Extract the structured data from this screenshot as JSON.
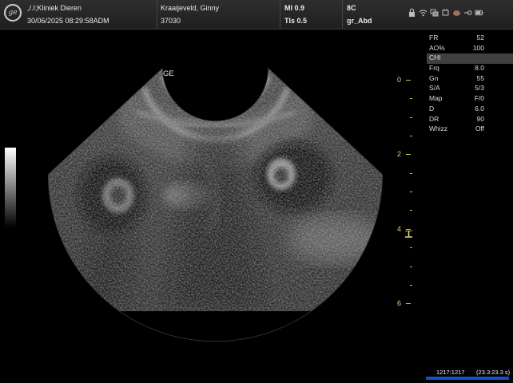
{
  "header": {
    "institution": ",/.I;Kliniek Dieren",
    "datetime": "30/06/2025 08:29:58ADM",
    "patient_name": "Kraaijeveld, Ginny",
    "patient_id": "37030",
    "mi": "MI 0.9",
    "tis": "TIs 0.5",
    "probe": "8C",
    "preset": "gr_Abd"
  },
  "image": {
    "orientation_marker": "GE"
  },
  "params": [
    {
      "label": "FR",
      "value": "52"
    },
    {
      "label": "AO%",
      "value": "100"
    },
    {
      "label": "CHI",
      "value": ""
    },
    {
      "label": "Frq",
      "value": "8.0"
    },
    {
      "label": "Gn",
      "value": "55"
    },
    {
      "label": "S/A",
      "value": "5/3"
    },
    {
      "label": "Map",
      "value": "F/0"
    },
    {
      "label": "D",
      "value": "6.0"
    },
    {
      "label": "DR",
      "value": "90"
    },
    {
      "label": "Whizz",
      "value": "Off"
    }
  ],
  "depth_scale": {
    "labels": [
      "0",
      "2",
      "4",
      "6"
    ],
    "max_depth_cm": 6
  },
  "cine": {
    "frames": "1217:1217",
    "time": "(23.3:23.3 s)"
  },
  "status_icons": [
    "lock-icon",
    "wifi-icon",
    "network-icon",
    "power-icon",
    "cloud-icon",
    "probe-icon",
    "battery-icon"
  ]
}
